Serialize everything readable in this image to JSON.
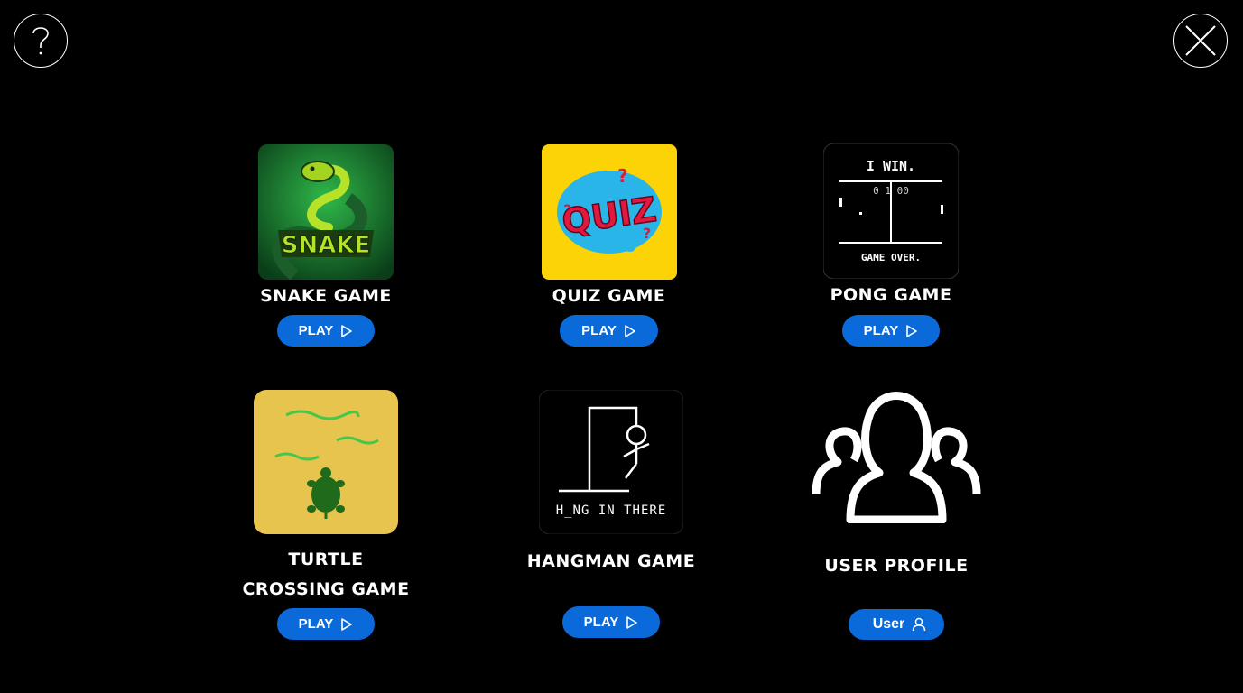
{
  "header": {
    "help_icon": "question-icon",
    "close_icon": "close-icon"
  },
  "games": [
    {
      "title": "SNAKE GAME",
      "button_label": "PLAY",
      "button_icon": "play-icon",
      "thumbnail_text": "SNAKE"
    },
    {
      "title": "QUIZ GAME",
      "button_label": "PLAY",
      "button_icon": "play-icon",
      "thumbnail_text": "QUIZ"
    },
    {
      "title": "PONG GAME",
      "button_label": "PLAY",
      "button_icon": "play-icon",
      "thumbnail_text_top": "I WIN.",
      "thumbnail_score": "0 1 00",
      "thumbnail_text_bottom": "GAME OVER."
    },
    {
      "title": "TURTLE CROSSING GAME",
      "button_label": "PLAY",
      "button_icon": "play-icon"
    },
    {
      "title": "HANGMAN GAME",
      "button_label": "PLAY",
      "button_icon": "play-icon",
      "thumbnail_text": "H_NG IN THERE"
    },
    {
      "title": "USER PROFILE",
      "button_label": "User",
      "button_icon": "user-icon"
    }
  ],
  "colors": {
    "background": "#000000",
    "button": "#0a6ad9",
    "text": "#ffffff"
  }
}
